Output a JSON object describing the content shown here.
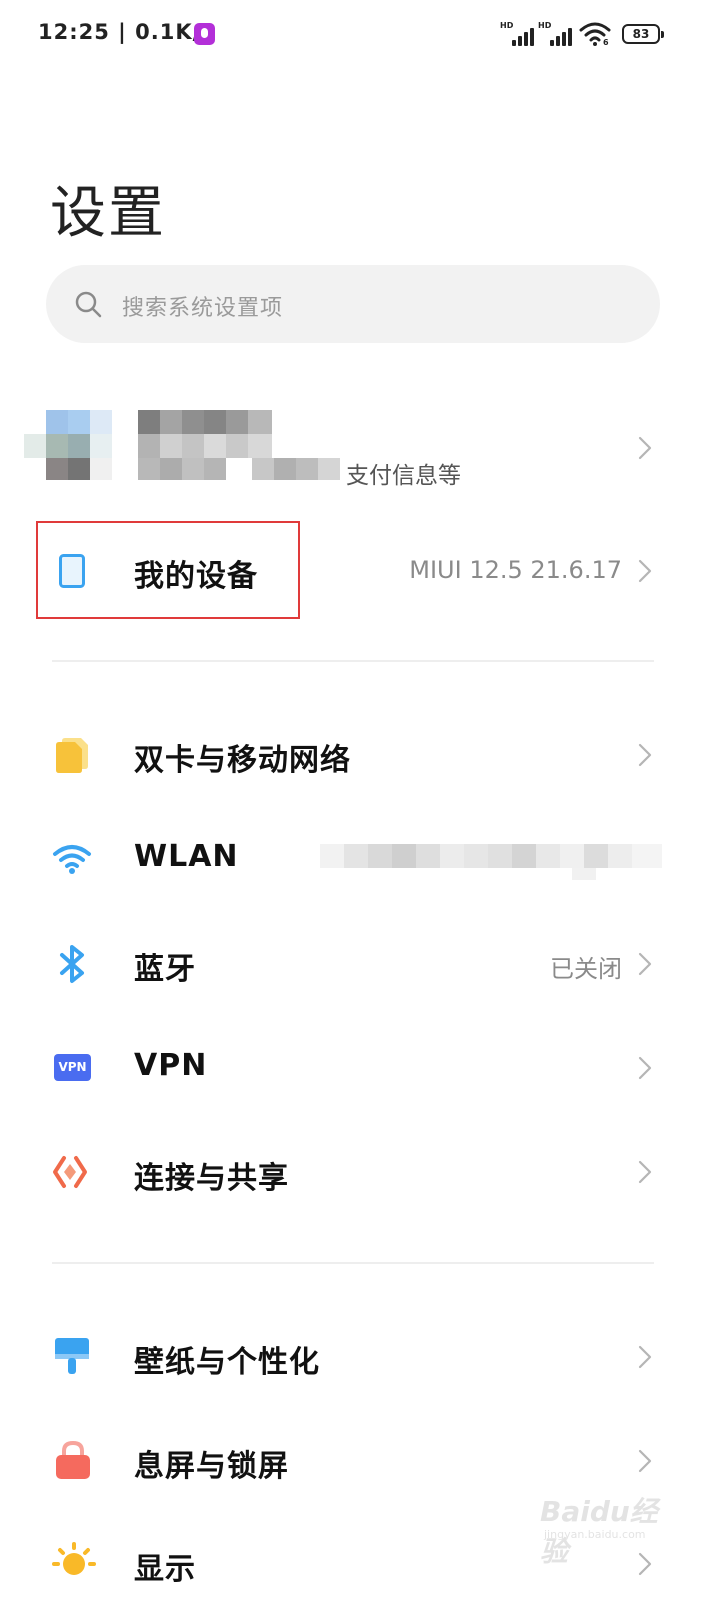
{
  "status_bar": {
    "time": "12:25 | 0.1K/s",
    "signal_1_label": "HD",
    "signal_2_label": "HD",
    "wifi_label": "6",
    "battery": "83"
  },
  "page": {
    "title": "设置"
  },
  "search": {
    "placeholder": "搜索系统设置项",
    "icon": "search-icon"
  },
  "account": {
    "subtitle": "支付信息等"
  },
  "my_device": {
    "label": "我的设备",
    "value": "MIUI 12.5 21.6.17",
    "icon": "tablet-icon",
    "highlight_color": "#e03a3a"
  },
  "network_items": [
    {
      "label": "双卡与移动网络",
      "value": "",
      "icon": "sim-card-icon"
    },
    {
      "label": "WLAN",
      "value": "",
      "icon": "wifi-icon"
    },
    {
      "label": "蓝牙",
      "value": "已关闭",
      "icon": "bluetooth-icon"
    },
    {
      "label": "VPN",
      "value": "",
      "icon": "vpn-icon",
      "icon_text": "VPN"
    },
    {
      "label": "连接与共享",
      "value": "",
      "icon": "share-icon"
    }
  ],
  "personal_items": [
    {
      "label": "壁纸与个性化",
      "value": "",
      "icon": "wallpaper-icon"
    },
    {
      "label": "息屏与锁屏",
      "value": "",
      "icon": "lock-icon"
    },
    {
      "label": "显示",
      "value": "",
      "icon": "sun-icon"
    }
  ],
  "watermark": {
    "text": "Baidu经验",
    "url": "jingyan.baidu.com"
  },
  "colors": {
    "accent_blue": "#3aa3f0",
    "sim_yellow": "#f7c23a",
    "vpn_blue": "#4a6cf0",
    "share_red": "#f06a4a",
    "lock_red": "#f56a5e",
    "sun_yellow": "#f9b928"
  }
}
